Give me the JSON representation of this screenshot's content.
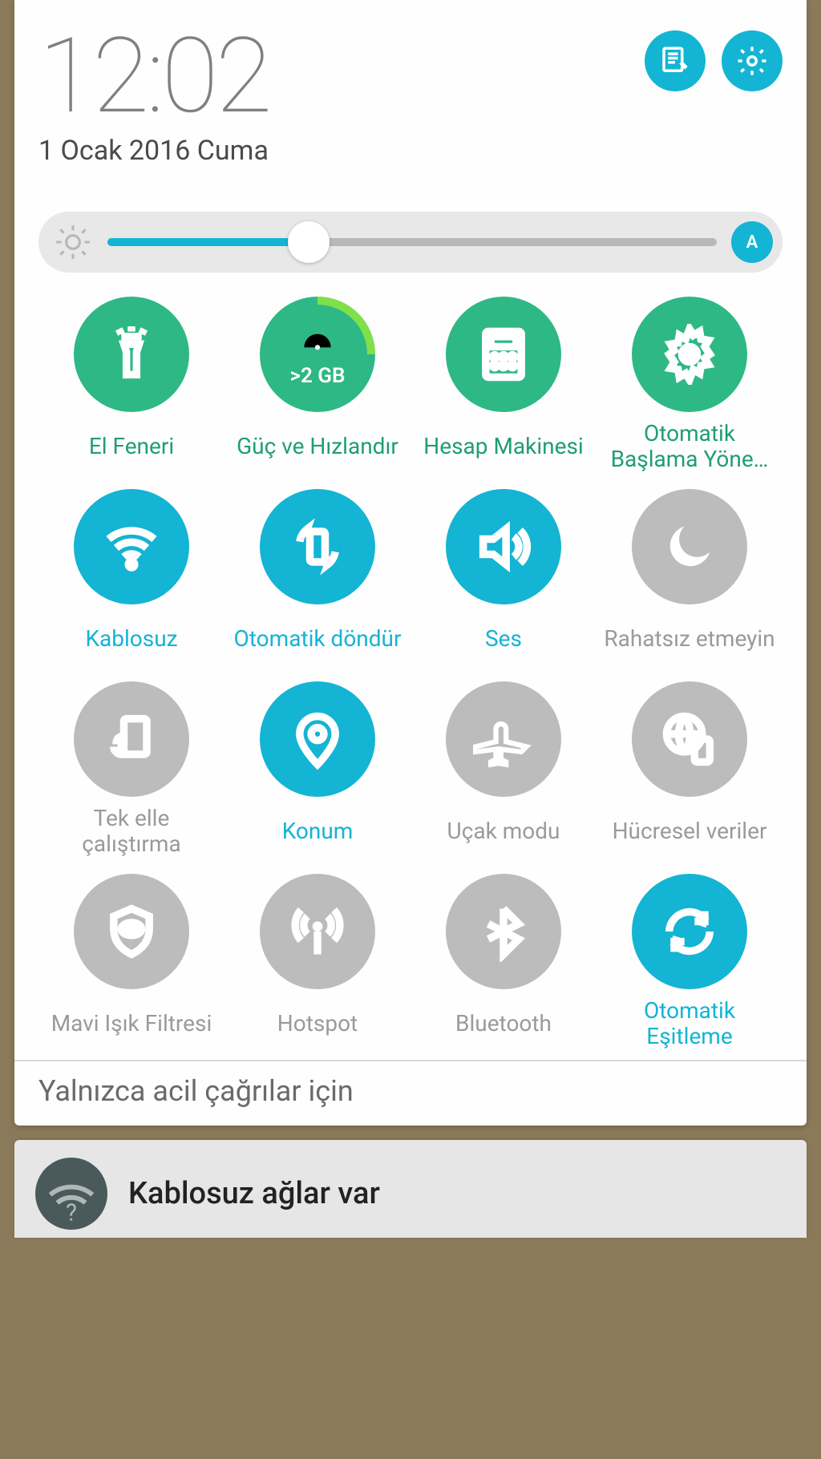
{
  "colors": {
    "green": "#2eb886",
    "cyan": "#14b4d4",
    "grey": "#bcbcbc"
  },
  "clock": {
    "time": "12:02",
    "date": "1 Ocak 2016 Cuma"
  },
  "brightness": {
    "percent": 33,
    "auto_label": "A"
  },
  "memory": {
    "threshold_label": ">2 GB"
  },
  "tiles": [
    {
      "key": "flashlight",
      "label": "El Feneri",
      "state": "green"
    },
    {
      "key": "boost",
      "label": "Güç ve Hızlandır",
      "state": "green"
    },
    {
      "key": "calculator",
      "label": "Hesap Makinesi",
      "state": "green"
    },
    {
      "key": "autostart",
      "label": "Otomatik Başlama Yöne…",
      "state": "green"
    },
    {
      "key": "wifi",
      "label": "Kablosuz",
      "state": "cyan"
    },
    {
      "key": "rotate",
      "label": "Otomatik döndür",
      "state": "cyan"
    },
    {
      "key": "sound",
      "label": "Ses",
      "state": "cyan"
    },
    {
      "key": "dnd",
      "label": "Rahatsız etmeyin",
      "state": "grey"
    },
    {
      "key": "onehand",
      "label": "Tek elle çalıştırma",
      "state": "grey"
    },
    {
      "key": "location",
      "label": "Konum",
      "state": "cyan"
    },
    {
      "key": "airplane",
      "label": "Uçak modu",
      "state": "grey"
    },
    {
      "key": "cellular",
      "label": "Hücresel veriler",
      "state": "grey"
    },
    {
      "key": "bluelight",
      "label": "Mavi Işık Filtresi",
      "state": "grey"
    },
    {
      "key": "hotspot",
      "label": "Hotspot",
      "state": "grey"
    },
    {
      "key": "bluetooth",
      "label": "Bluetooth",
      "state": "grey"
    },
    {
      "key": "sync",
      "label": "Otomatik Eşitleme",
      "state": "cyan"
    }
  ],
  "status_bar": "Yalnızca acil çağrılar için",
  "notification": {
    "title": "Kablosuz ağlar var"
  }
}
